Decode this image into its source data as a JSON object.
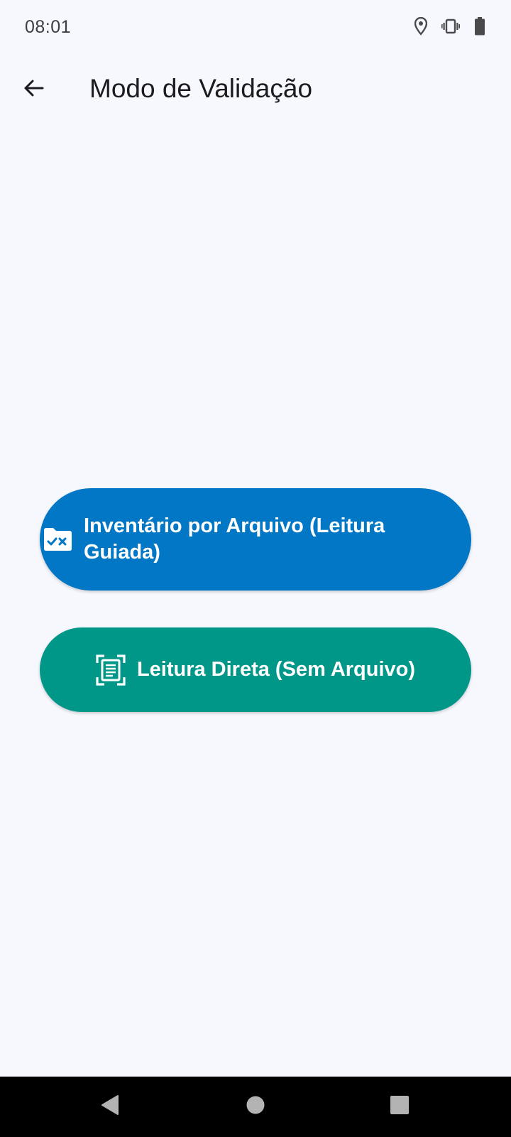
{
  "status_bar": {
    "time": "08:01",
    "icons": [
      "location-icon",
      "vibrate-icon",
      "battery-icon"
    ]
  },
  "app_bar": {
    "title": "Modo de Validação",
    "back_icon": "arrow-back-icon"
  },
  "options": [
    {
      "label": "Inventário por Arquivo (Leitura Guiada)",
      "icon": "folder-check-x-icon",
      "color": "#0277c6"
    },
    {
      "label": "Leitura Direta (Sem Arquivo)",
      "icon": "document-scanner-icon",
      "color": "#009789"
    }
  ],
  "nav_bar": {
    "buttons": [
      "nav-back-icon",
      "nav-home-icon",
      "nav-recents-icon"
    ]
  },
  "colors": {
    "background": "#f7f8fd",
    "primary": "#0277c6",
    "secondary": "#009789"
  }
}
